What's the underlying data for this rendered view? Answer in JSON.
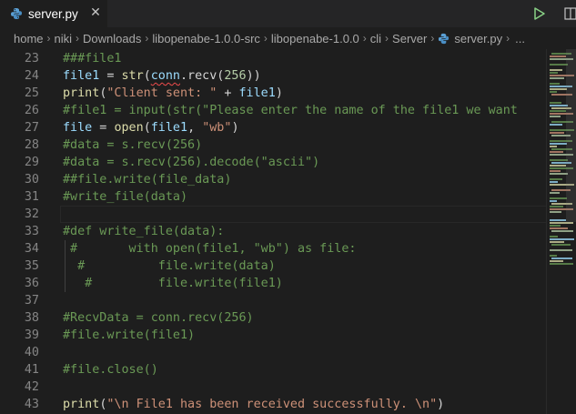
{
  "tab": {
    "filename": "server.py"
  },
  "icons": {
    "file_icon": "python-file-icon",
    "close": "close-icon",
    "run": "run-icon",
    "split": "split-editor-icon"
  },
  "colors": {
    "editor_bg": "#1e1e1e",
    "tabbar_bg": "#252526",
    "comment": "#6a9955",
    "function": "#dcdcaa",
    "string": "#ce9178",
    "number": "#b5cea8",
    "variable": "#9cdcfe",
    "run_green": "#89d185",
    "python_blue": "#3572a5"
  },
  "breadcrumb": {
    "items": [
      "home",
      "niki",
      "Downloads",
      "libopenabe-1.0.0-src",
      "libopenabe-1.0.0",
      "cli",
      "Server"
    ],
    "file": "server.py",
    "more": "..."
  },
  "editor": {
    "lines": [
      {
        "num": "23",
        "tokens": [
          {
            "t": "###file1",
            "c": "com"
          }
        ]
      },
      {
        "num": "24",
        "tokens": [
          {
            "t": "file1",
            "c": "var"
          },
          {
            "t": " = ",
            "c": "pl"
          },
          {
            "t": "str",
            "c": "fn"
          },
          {
            "t": "(",
            "c": "pl"
          },
          {
            "t": "conn",
            "c": "var",
            "sq": true
          },
          {
            "t": ".recv(",
            "c": "pl"
          },
          {
            "t": "256",
            "c": "num"
          },
          {
            "t": "))",
            "c": "pl"
          }
        ]
      },
      {
        "num": "25",
        "tokens": [
          {
            "t": "print",
            "c": "fn"
          },
          {
            "t": "(",
            "c": "pl"
          },
          {
            "t": "\"Client sent: \"",
            "c": "str"
          },
          {
            "t": " + ",
            "c": "pl"
          },
          {
            "t": "file1",
            "c": "var"
          },
          {
            "t": ")",
            "c": "pl"
          }
        ]
      },
      {
        "num": "26",
        "tokens": [
          {
            "t": "#file1 = input(str(\"Please enter the name of the file1 we want",
            "c": "com"
          }
        ]
      },
      {
        "num": "27",
        "tokens": [
          {
            "t": "file",
            "c": "var"
          },
          {
            "t": " = ",
            "c": "pl"
          },
          {
            "t": "open",
            "c": "fn"
          },
          {
            "t": "(",
            "c": "pl"
          },
          {
            "t": "file1",
            "c": "var"
          },
          {
            "t": ", ",
            "c": "pl"
          },
          {
            "t": "\"wb\"",
            "c": "str"
          },
          {
            "t": ")",
            "c": "pl"
          }
        ]
      },
      {
        "num": "28",
        "tokens": [
          {
            "t": "#data = s.recv(256)",
            "c": "com"
          }
        ]
      },
      {
        "num": "29",
        "tokens": [
          {
            "t": "#data = s.recv(256).decode(\"ascii\")",
            "c": "com"
          }
        ]
      },
      {
        "num": "30",
        "tokens": [
          {
            "t": "##file.write(file_data)",
            "c": "com"
          }
        ]
      },
      {
        "num": "31",
        "tokens": [
          {
            "t": "#write_file(data)",
            "c": "com"
          }
        ]
      },
      {
        "num": "32",
        "tokens": [],
        "current": true
      },
      {
        "num": "33",
        "tokens": [
          {
            "t": "#def write_file(data):",
            "c": "com"
          }
        ]
      },
      {
        "num": "34",
        "tokens": [
          {
            "t": " #       with open(file1, \"wb\") as file:",
            "c": "com"
          }
        ]
      },
      {
        "num": "35",
        "tokens": [
          {
            "t": "  #          file.write(data)",
            "c": "com"
          }
        ]
      },
      {
        "num": "36",
        "tokens": [
          {
            "t": "   #         file.write(file1)",
            "c": "com"
          }
        ]
      },
      {
        "num": "37",
        "tokens": []
      },
      {
        "num": "38",
        "tokens": [
          {
            "t": "#RecvData = conn.recv(256)",
            "c": "com"
          }
        ]
      },
      {
        "num": "39",
        "tokens": [
          {
            "t": "#file.write(file1)",
            "c": "com"
          }
        ]
      },
      {
        "num": "40",
        "tokens": []
      },
      {
        "num": "41",
        "tokens": [
          {
            "t": "#file.close()",
            "c": "com"
          }
        ]
      },
      {
        "num": "42",
        "tokens": []
      },
      {
        "num": "43",
        "tokens": [
          {
            "t": "print",
            "c": "fn"
          },
          {
            "t": "(",
            "c": "pl"
          },
          {
            "t": "\"\\n File1 has been received successfully. \\n\"",
            "c": "str"
          },
          {
            "t": ")",
            "c": "pl"
          }
        ]
      }
    ]
  }
}
